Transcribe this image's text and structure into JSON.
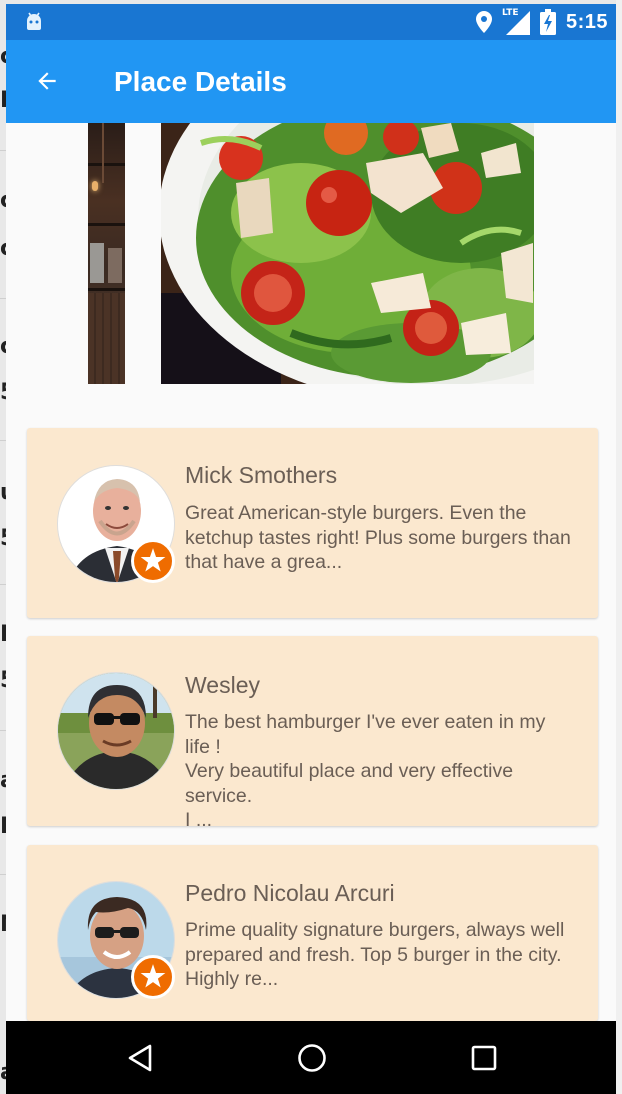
{
  "status_bar": {
    "time": "5:15",
    "network_label": "LTE",
    "icons": [
      "android-icon",
      "location-icon",
      "signal-icon",
      "battery-icon"
    ]
  },
  "app_bar": {
    "title": "Place Details",
    "back_icon": "arrow-back-icon",
    "background": "#2196f3",
    "status_background": "#1976d2"
  },
  "gallery": {
    "photos": [
      "restaurant-interior-photo",
      "salad-photo"
    ]
  },
  "reviews": [
    {
      "name": "Mick Smothers",
      "text": "Great American-style burgers. Even the ketchup tastes right! Plus some burgers than that have a grea...",
      "has_badge": true
    },
    {
      "name": "Wesley",
      "text": "The best hamburger I've ever eaten in my life !\nVery beautiful place and very effective service.\nI ...",
      "has_badge": false
    },
    {
      "name": "Pedro Nicolau Arcuri",
      "text": "Prime quality signature burgers, always well prepared and fresh. Top 5 burger in the city. Highly re...",
      "has_badge": true
    }
  ],
  "colors": {
    "card_background": "#fbe8cf",
    "card_text": "#6a5e55",
    "badge": "#ef6c00"
  },
  "nav_bar": {
    "back_icon": "nav-back-icon",
    "home_icon": "nav-home-icon",
    "recents_icon": "nav-recents-icon"
  }
}
